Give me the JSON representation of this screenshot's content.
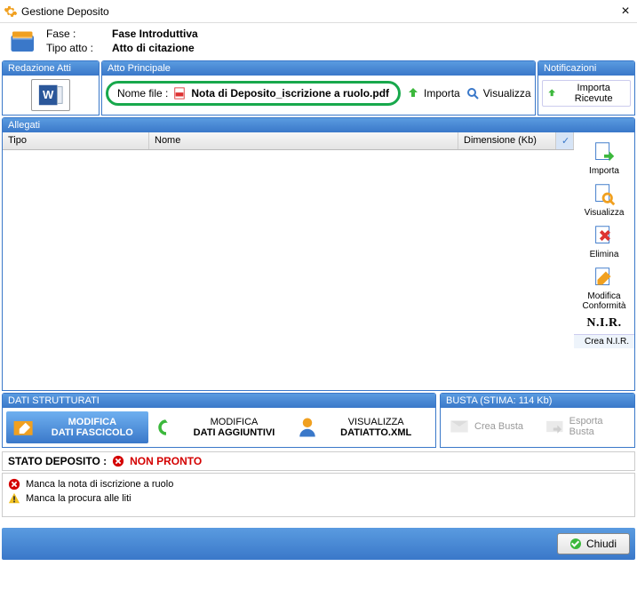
{
  "window": {
    "title": "Gestione Deposito"
  },
  "header": {
    "fase_label": "Fase :",
    "fase_value": "Fase Introduttiva",
    "tipo_label": "Tipo atto :",
    "tipo_value": "Atto di citazione"
  },
  "redazione": {
    "title": "Redazione Atti"
  },
  "principale": {
    "title": "Atto Principale",
    "nomefile_label": "Nome file :",
    "nomefile_value": "Nota di Deposito_iscrizione a ruolo.pdf",
    "importa": "Importa",
    "visualizza": "Visualizza"
  },
  "notifica": {
    "title": "Notificazioni",
    "btn": "Importa Ricevute"
  },
  "allegati": {
    "title": "Allegati",
    "cols": {
      "tipo": "Tipo",
      "nome": "Nome",
      "dim": "Dimensione (Kb)"
    },
    "side": {
      "importa": "Importa",
      "visualizza": "Visualizza",
      "elimina": "Elimina",
      "modifica": "Modifica Conformità",
      "nir": "N.I.R.",
      "crea_nir": "Crea N.I.R."
    }
  },
  "dati": {
    "title": "DATI STRUTTURATI",
    "b1": {
      "l1": "MODIFICA",
      "l2": "DATI FASCICOLO"
    },
    "b2": {
      "l1": "MODIFICA",
      "l2": "DATI AGGIUNTIVI"
    },
    "b3": {
      "l1": "VISUALIZZA",
      "l2": "DATIATTO.XML"
    }
  },
  "busta": {
    "title": "BUSTA (STIMA: 114 Kb)",
    "crea": "Crea Busta",
    "esporta": "Esporta Busta"
  },
  "status": {
    "label": "STATO DEPOSITO :",
    "value": "NON PRONTO",
    "msgs": [
      "Manca la nota di iscrizione a ruolo",
      "Manca la procura alle liti"
    ]
  },
  "footer": {
    "chiudi": "Chiudi"
  }
}
